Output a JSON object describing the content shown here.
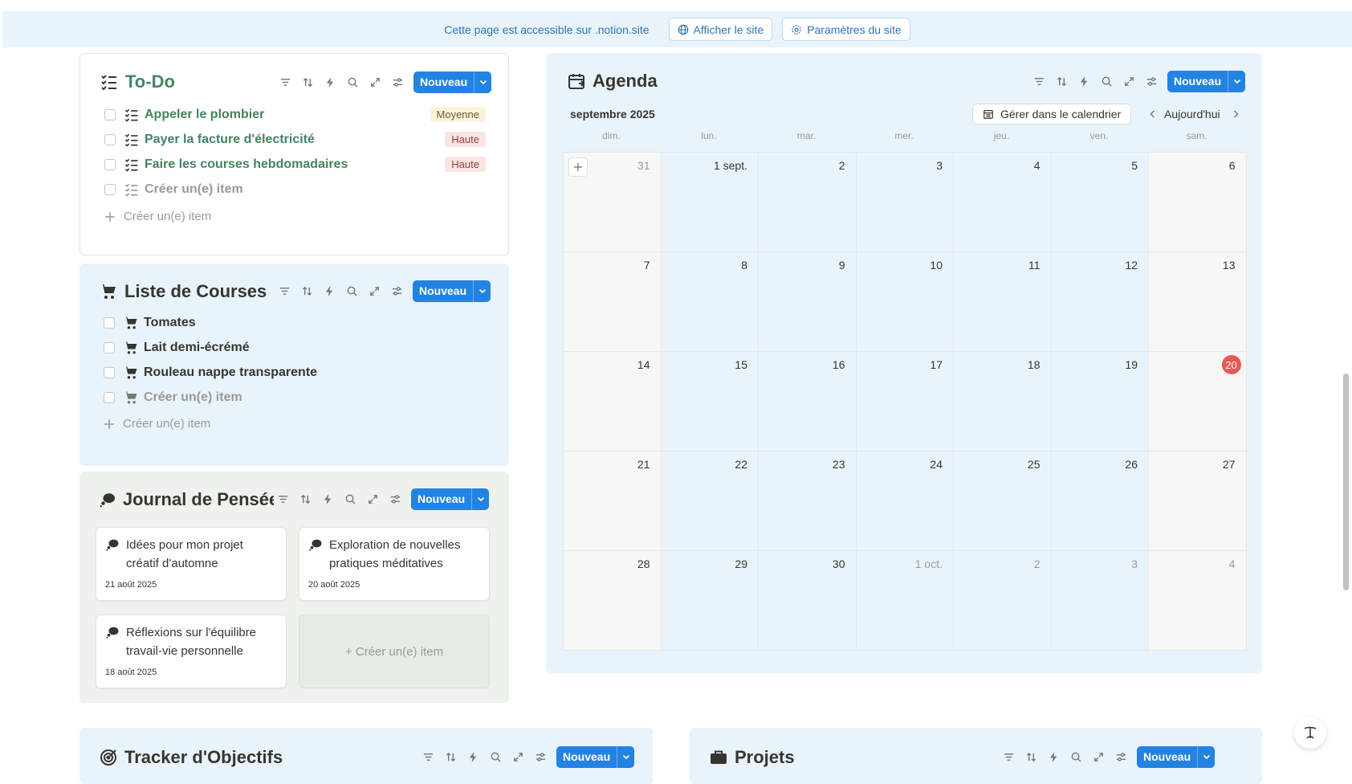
{
  "banner": {
    "text": "Cette page est accessible sur .notion.site",
    "view_site": "Afficher le site",
    "site_settings": "Paramètres du site"
  },
  "new_label": "Nouveau",
  "todo": {
    "title": "To-Do",
    "items": [
      {
        "label": "Appeler le plombier",
        "priority": "Moyenne"
      },
      {
        "label": "Payer la facture d'électricité",
        "priority": "Haute"
      },
      {
        "label": "Faire les courses hebdomadaires",
        "priority": "Haute"
      }
    ],
    "create_placeholder": "Créer un(e) item",
    "add_label": "Créer un(e) item"
  },
  "shopping": {
    "title": "Liste de Courses",
    "items": [
      "Tomates",
      "Lait demi-écrémé",
      "Rouleau nappe transparente"
    ],
    "create_placeholder": "Créer un(e) item",
    "add_label": "Créer un(e) item"
  },
  "journal": {
    "title": "Journal de Pensées",
    "cards": [
      {
        "title": "Idées pour mon projet créatif d'automne",
        "date": "21 août 2025"
      },
      {
        "title": "Exploration de nouvelles pratiques méditatives",
        "date": "20 août 2025"
      },
      {
        "title": "Réflexions sur l'équilibre travail-vie personnelle",
        "date": "18 août 2025"
      }
    ],
    "add_label": "+ Créer un(e) item"
  },
  "agenda": {
    "title": "Agenda",
    "month": "septembre 2025",
    "manage_label": "Gérer dans le calendrier",
    "today_label": "Aujourd'hui",
    "weekdays": [
      "dim.",
      "lun.",
      "mar.",
      "mer.",
      "jeu.",
      "ven.",
      "sam."
    ],
    "weeks": [
      [
        {
          "d": "31",
          "dim": true
        },
        {
          "d": "1 sept."
        },
        {
          "d": "2"
        },
        {
          "d": "3"
        },
        {
          "d": "4"
        },
        {
          "d": "5"
        },
        {
          "d": "6"
        }
      ],
      [
        {
          "d": "7"
        },
        {
          "d": "8"
        },
        {
          "d": "9"
        },
        {
          "d": "10"
        },
        {
          "d": "11"
        },
        {
          "d": "12"
        },
        {
          "d": "13"
        }
      ],
      [
        {
          "d": "14"
        },
        {
          "d": "15"
        },
        {
          "d": "16"
        },
        {
          "d": "17"
        },
        {
          "d": "18"
        },
        {
          "d": "19"
        },
        {
          "d": "20",
          "today": true
        }
      ],
      [
        {
          "d": "21"
        },
        {
          "d": "22"
        },
        {
          "d": "23"
        },
        {
          "d": "24"
        },
        {
          "d": "25"
        },
        {
          "d": "26"
        },
        {
          "d": "27"
        }
      ],
      [
        {
          "d": "28"
        },
        {
          "d": "29"
        },
        {
          "d": "30"
        },
        {
          "d": "1 oct.",
          "dim": true
        },
        {
          "d": "2",
          "dim": true
        },
        {
          "d": "3",
          "dim": true
        },
        {
          "d": "4",
          "dim": true
        }
      ]
    ]
  },
  "goals": {
    "title": "Tracker d'Objectifs"
  },
  "projects": {
    "title": "Projets"
  },
  "colors": {
    "accent": "#2383e2",
    "todo_title": "#448361",
    "panel_blue": "#e9f3fb",
    "panel_green": "#edf3ec",
    "badge_medium_bg": "#fbf3db",
    "badge_high_bg": "#fbe4e4",
    "today": "#eb5757"
  }
}
